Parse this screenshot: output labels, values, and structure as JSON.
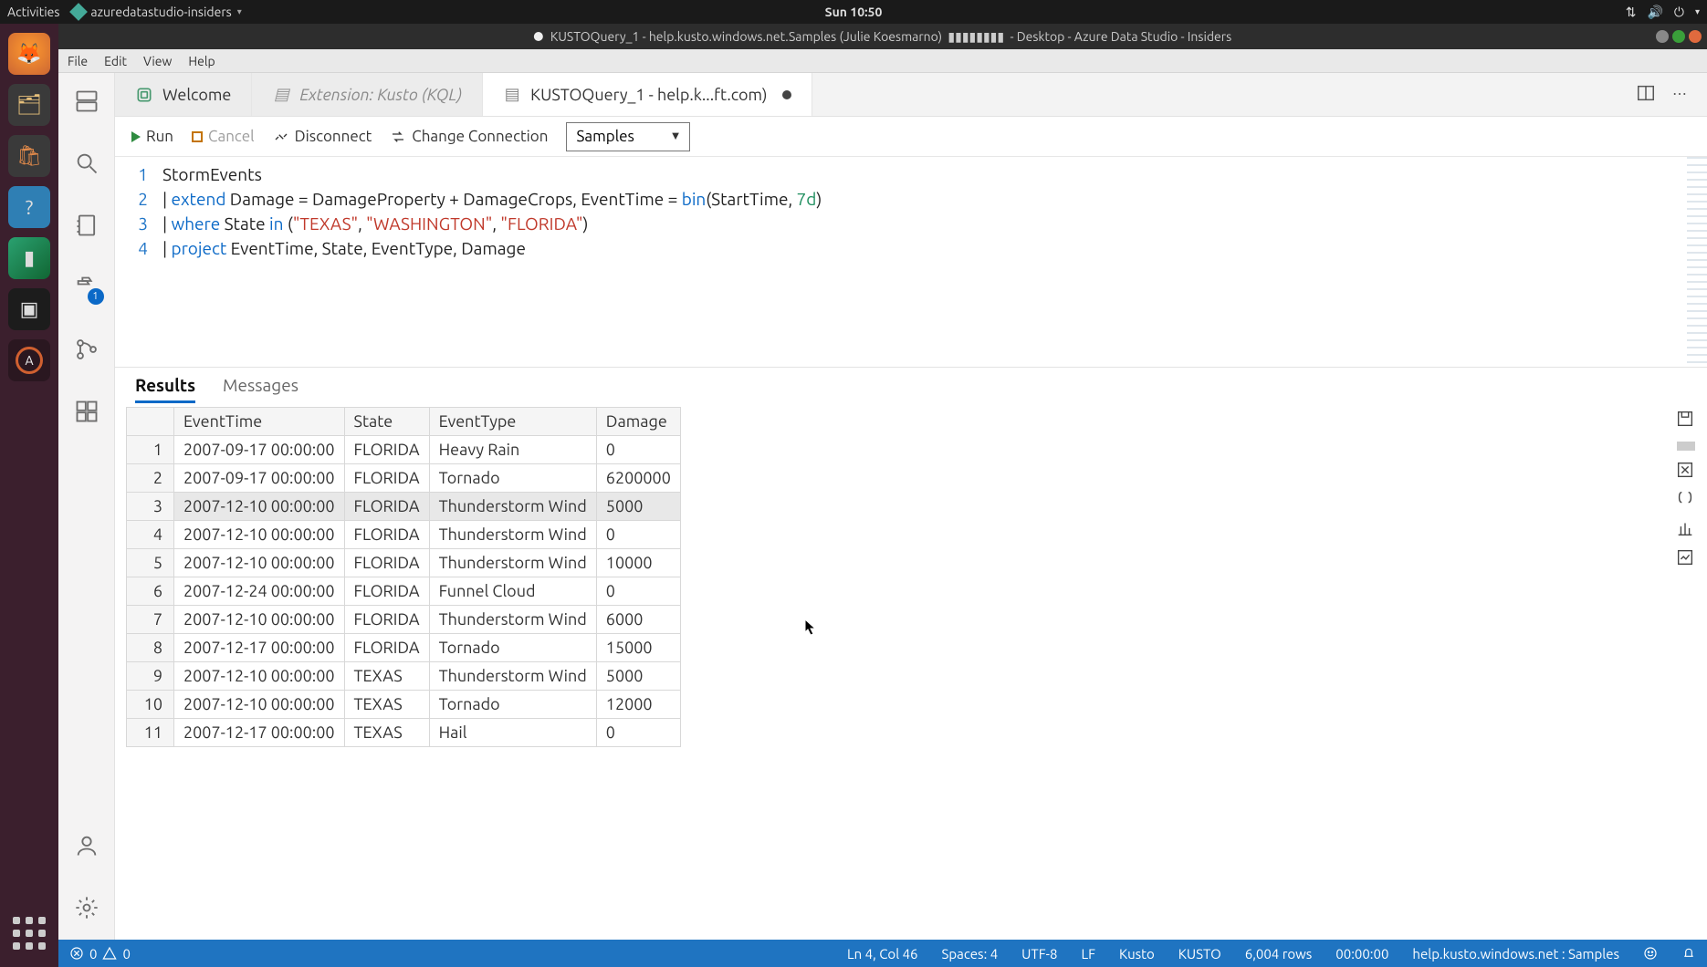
{
  "gnome": {
    "activities": "Activities",
    "app": "azuredatastudio-insiders",
    "clock": "Sun 10:50"
  },
  "window_title": "KUSTOQuery_1 - help.kusto.windows.net.Samples (Julie Koesmarno)",
  "window_title_suffix": " - Desktop - Azure Data Studio - Insiders",
  "menubar": [
    "File",
    "Edit",
    "View",
    "Help"
  ],
  "tabs": [
    {
      "label": "Welcome"
    },
    {
      "label": "Extension: Kusto (KQL)"
    },
    {
      "label": "KUSTOQuery_1 - help.k...ft.com)"
    }
  ],
  "activity_badge": "1",
  "qbar": {
    "run": "Run",
    "cancel": "Cancel",
    "disconnect": "Disconnect",
    "change": "Change Connection",
    "db": "Samples"
  },
  "editor": {
    "lines": [
      "1",
      "2",
      "3",
      "4"
    ],
    "l1": "StormEvents",
    "l2a": "| ",
    "l2b": "extend",
    "l2c": " Damage = DamageProperty + DamageCrops, EventTime = ",
    "l2d": "bin",
    "l2e": "(StartTime, ",
    "l2f": "7d",
    "l2g": ")",
    "l3a": "| ",
    "l3b": "where",
    "l3c": " State ",
    "l3d": "in",
    "l3e": " (",
    "l3f": "\"TEXAS\"",
    "l3g": ", ",
    "l3h": "\"WASHINGTON\"",
    "l3i": ", ",
    "l3j": "\"FLORIDA\"",
    "l3k": ")",
    "l4a": "| ",
    "l4b": "project",
    "l4c": " EventTime, State, EventType, Damage"
  },
  "results_tabs": {
    "results": "Results",
    "messages": "Messages"
  },
  "columns": [
    "EventTime",
    "State",
    "EventType",
    "Damage"
  ],
  "rows": [
    {
      "n": "1",
      "t": "2007-09-17 00:00:00",
      "s": "FLORIDA",
      "e": "Heavy Rain",
      "d": "0"
    },
    {
      "n": "2",
      "t": "2007-09-17 00:00:00",
      "s": "FLORIDA",
      "e": "Tornado",
      "d": "6200000"
    },
    {
      "n": "3",
      "t": "2007-12-10 00:00:00",
      "s": "FLORIDA",
      "e": "Thunderstorm Wind",
      "d": "5000"
    },
    {
      "n": "4",
      "t": "2007-12-10 00:00:00",
      "s": "FLORIDA",
      "e": "Thunderstorm Wind",
      "d": "0"
    },
    {
      "n": "5",
      "t": "2007-12-10 00:00:00",
      "s": "FLORIDA",
      "e": "Thunderstorm Wind",
      "d": "10000"
    },
    {
      "n": "6",
      "t": "2007-12-24 00:00:00",
      "s": "FLORIDA",
      "e": "Funnel Cloud",
      "d": "0"
    },
    {
      "n": "7",
      "t": "2007-12-10 00:00:00",
      "s": "FLORIDA",
      "e": "Thunderstorm Wind",
      "d": "6000"
    },
    {
      "n": "8",
      "t": "2007-12-17 00:00:00",
      "s": "FLORIDA",
      "e": "Tornado",
      "d": "15000"
    },
    {
      "n": "9",
      "t": "2007-12-10 00:00:00",
      "s": "TEXAS",
      "e": "Thunderstorm Wind",
      "d": "5000"
    },
    {
      "n": "10",
      "t": "2007-12-10 00:00:00",
      "s": "TEXAS",
      "e": "Tornado",
      "d": "12000"
    },
    {
      "n": "11",
      "t": "2007-12-17 00:00:00",
      "s": "TEXAS",
      "e": "Hail",
      "d": "0"
    }
  ],
  "status": {
    "errors": "0",
    "warnings": "0",
    "cursor": "Ln 4, Col 46",
    "spaces": "Spaces: 4",
    "enc": "UTF-8",
    "eol": "LF",
    "lang": "Kusto",
    "lang2": "KUSTO",
    "rows": "6,004 rows",
    "time": "00:00:00",
    "conn": "help.kusto.windows.net : Samples"
  }
}
